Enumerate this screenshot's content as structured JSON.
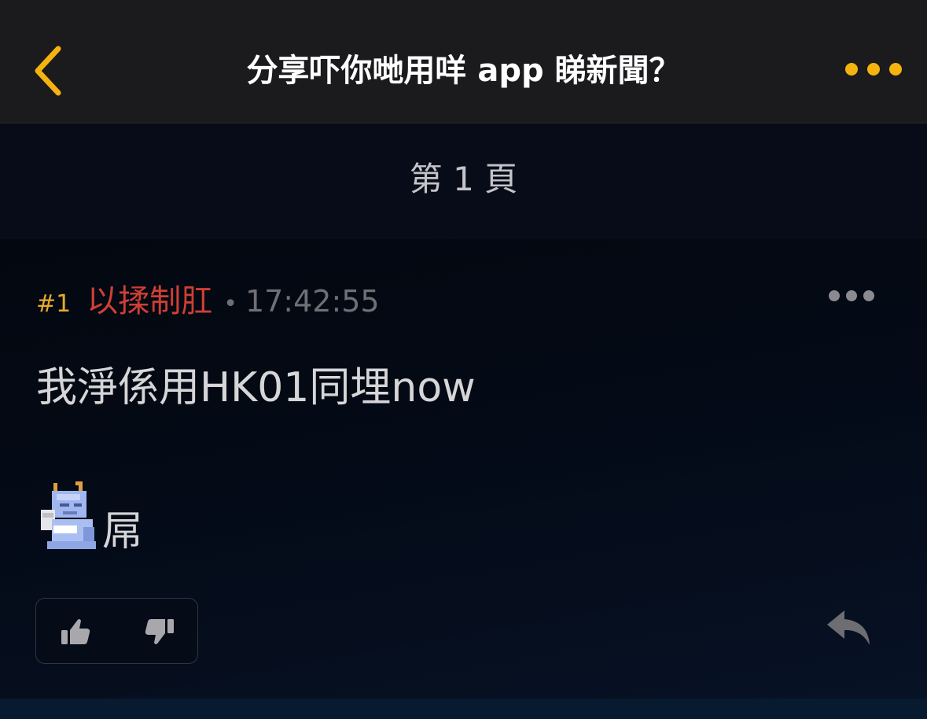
{
  "header": {
    "title": "分享吓你哋用咩 app 睇新聞？",
    "back_icon": "chevron-left-icon",
    "more_icon": "more-dots-icon",
    "accent_color": "#f5b30f"
  },
  "pagination": {
    "label": "第 1 頁"
  },
  "post": {
    "number": "#1",
    "author": "以揉制肛",
    "separator": "•",
    "time": "17:42:55",
    "content_line1": "我淨係用HK01同埋now",
    "content_line2": "屌",
    "emoji_icon": "dragon-emoji-icon",
    "author_color": "#cf3f34",
    "number_color": "#e7a92a"
  },
  "actions": {
    "upvote_icon": "thumbs-up-icon",
    "downvote_icon": "thumbs-down-icon",
    "reply_icon": "reply-icon"
  }
}
